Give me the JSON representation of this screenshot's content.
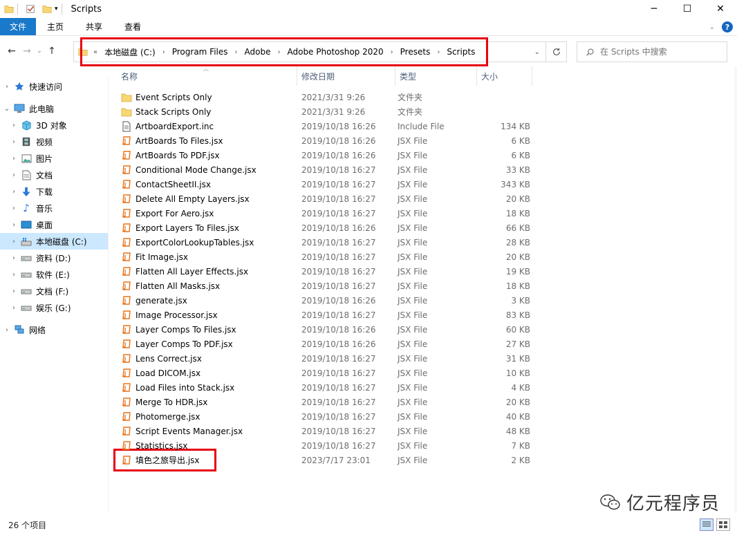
{
  "window": {
    "title": "Scripts"
  },
  "ribbon": {
    "tabs": [
      "文件",
      "主页",
      "共享",
      "查看"
    ],
    "help": "?"
  },
  "address": {
    "overflow": "«",
    "crumbs": [
      "本地磁盘 (C:)",
      "Program Files",
      "Adobe",
      "Adobe Photoshop 2020",
      "Presets",
      "Scripts"
    ]
  },
  "search": {
    "placeholder": "在 Scripts 中搜索"
  },
  "columns": {
    "name": "名称",
    "date": "修改日期",
    "type": "类型",
    "size": "大小"
  },
  "sidebar": {
    "quick_access": "快速访问",
    "this_pc": "此电脑",
    "items": [
      "3D 对象",
      "视频",
      "图片",
      "文档",
      "下载",
      "音乐",
      "桌面",
      "本地磁盘 (C:)",
      "资料 (D:)",
      "软件 (E:)",
      "文档 (F:)",
      "娱乐 (G:)"
    ],
    "network": "网络"
  },
  "files": [
    {
      "name": "Event Scripts Only",
      "date": "2021/3/31 9:26",
      "type": "文件夹",
      "size": "",
      "icon": "folder"
    },
    {
      "name": "Stack Scripts Only",
      "date": "2021/3/31 9:26",
      "type": "文件夹",
      "size": "",
      "icon": "folder"
    },
    {
      "name": "ArtboardExport.inc",
      "date": "2019/10/18 16:26",
      "type": "Include File",
      "size": "134 KB",
      "icon": "doc"
    },
    {
      "name": "ArtBoards To Files.jsx",
      "date": "2019/10/18 16:26",
      "type": "JSX File",
      "size": "6 KB",
      "icon": "jsx"
    },
    {
      "name": "ArtBoards To PDF.jsx",
      "date": "2019/10/18 16:26",
      "type": "JSX File",
      "size": "6 KB",
      "icon": "jsx"
    },
    {
      "name": "Conditional Mode Change.jsx",
      "date": "2019/10/18 16:27",
      "type": "JSX File",
      "size": "33 KB",
      "icon": "jsx"
    },
    {
      "name": "ContactSheetII.jsx",
      "date": "2019/10/18 16:27",
      "type": "JSX File",
      "size": "343 KB",
      "icon": "jsx"
    },
    {
      "name": "Delete All Empty Layers.jsx",
      "date": "2019/10/18 16:27",
      "type": "JSX File",
      "size": "20 KB",
      "icon": "jsx"
    },
    {
      "name": "Export For Aero.jsx",
      "date": "2019/10/18 16:27",
      "type": "JSX File",
      "size": "18 KB",
      "icon": "jsx"
    },
    {
      "name": "Export Layers To Files.jsx",
      "date": "2019/10/18 16:26",
      "type": "JSX File",
      "size": "66 KB",
      "icon": "jsx"
    },
    {
      "name": "ExportColorLookupTables.jsx",
      "date": "2019/10/18 16:27",
      "type": "JSX File",
      "size": "28 KB",
      "icon": "jsx"
    },
    {
      "name": "Fit Image.jsx",
      "date": "2019/10/18 16:27",
      "type": "JSX File",
      "size": "20 KB",
      "icon": "jsx"
    },
    {
      "name": "Flatten All Layer Effects.jsx",
      "date": "2019/10/18 16:27",
      "type": "JSX File",
      "size": "19 KB",
      "icon": "jsx"
    },
    {
      "name": "Flatten All Masks.jsx",
      "date": "2019/10/18 16:27",
      "type": "JSX File",
      "size": "18 KB",
      "icon": "jsx"
    },
    {
      "name": "generate.jsx",
      "date": "2019/10/18 16:26",
      "type": "JSX File",
      "size": "3 KB",
      "icon": "jsx"
    },
    {
      "name": "Image Processor.jsx",
      "date": "2019/10/18 16:27",
      "type": "JSX File",
      "size": "83 KB",
      "icon": "jsx"
    },
    {
      "name": "Layer Comps To Files.jsx",
      "date": "2019/10/18 16:26",
      "type": "JSX File",
      "size": "60 KB",
      "icon": "jsx"
    },
    {
      "name": "Layer Comps To PDF.jsx",
      "date": "2019/10/18 16:26",
      "type": "JSX File",
      "size": "27 KB",
      "icon": "jsx"
    },
    {
      "name": "Lens Correct.jsx",
      "date": "2019/10/18 16:27",
      "type": "JSX File",
      "size": "31 KB",
      "icon": "jsx"
    },
    {
      "name": "Load DICOM.jsx",
      "date": "2019/10/18 16:27",
      "type": "JSX File",
      "size": "10 KB",
      "icon": "jsx"
    },
    {
      "name": "Load Files into Stack.jsx",
      "date": "2019/10/18 16:27",
      "type": "JSX File",
      "size": "4 KB",
      "icon": "jsx"
    },
    {
      "name": "Merge To HDR.jsx",
      "date": "2019/10/18 16:27",
      "type": "JSX File",
      "size": "20 KB",
      "icon": "jsx"
    },
    {
      "name": "Photomerge.jsx",
      "date": "2019/10/18 16:27",
      "type": "JSX File",
      "size": "40 KB",
      "icon": "jsx"
    },
    {
      "name": "Script Events Manager.jsx",
      "date": "2019/10/18 16:27",
      "type": "JSX File",
      "size": "48 KB",
      "icon": "jsx"
    },
    {
      "name": "Statistics.jsx",
      "date": "2019/10/18 16:27",
      "type": "JSX File",
      "size": "7 KB",
      "icon": "jsx"
    },
    {
      "name": "填色之旅导出.jsx",
      "date": "2023/7/17 23:01",
      "type": "JSX File",
      "size": "2 KB",
      "icon": "jsx"
    }
  ],
  "status": {
    "count": "26 个项目"
  },
  "watermark": {
    "text": "亿元程序员"
  },
  "colors": {
    "accent": "#1979ca",
    "highlight": "#e60012",
    "selected": "#cce8ff",
    "jsx_icon": "#e8731a",
    "folder": "#f8d775"
  }
}
